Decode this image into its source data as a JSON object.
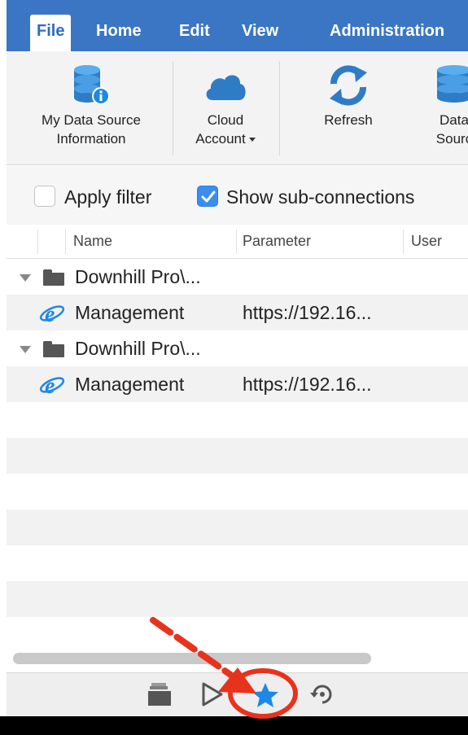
{
  "menu": {
    "tabs": [
      "File",
      "Home",
      "Edit",
      "View",
      "Administration"
    ],
    "active": "File"
  },
  "ribbon": {
    "buttons": [
      {
        "line1": "My Data Source",
        "line2": "Information",
        "icon": "database-info-icon"
      },
      {
        "line1": "Cloud",
        "line2": "Account",
        "icon": "cloud-icon",
        "dropdown": true
      },
      {
        "line1": "Refresh",
        "line2": "",
        "icon": "refresh-icon"
      },
      {
        "line1": "Data",
        "line2": "Sourc",
        "icon": "database-icon"
      }
    ]
  },
  "filters": {
    "apply_filter": {
      "label": "Apply filter",
      "checked": false
    },
    "show_sub": {
      "label": "Show sub-connections",
      "checked": true
    }
  },
  "columns": [
    "Name",
    "Parameter",
    "User"
  ],
  "tree": [
    {
      "type": "folder",
      "name": "Downhill Pro\\...",
      "parameter": ""
    },
    {
      "type": "web",
      "name": "Management",
      "parameter": "https://192.16..."
    },
    {
      "type": "folder",
      "name": "Downhill Pro\\...",
      "parameter": ""
    },
    {
      "type": "web",
      "name": "Management",
      "parameter": "https://192.16..."
    }
  ],
  "colors": {
    "menubar": "#3a76c4",
    "accent": "#3b8ef0",
    "annotation": "#e8331c"
  },
  "bottombar_icons": [
    "documents-icon",
    "play-icon",
    "favorites-star-icon",
    "history-icon"
  ],
  "annotation": {
    "target": "favorites-star-icon",
    "shape": "circle-with-arrow"
  }
}
